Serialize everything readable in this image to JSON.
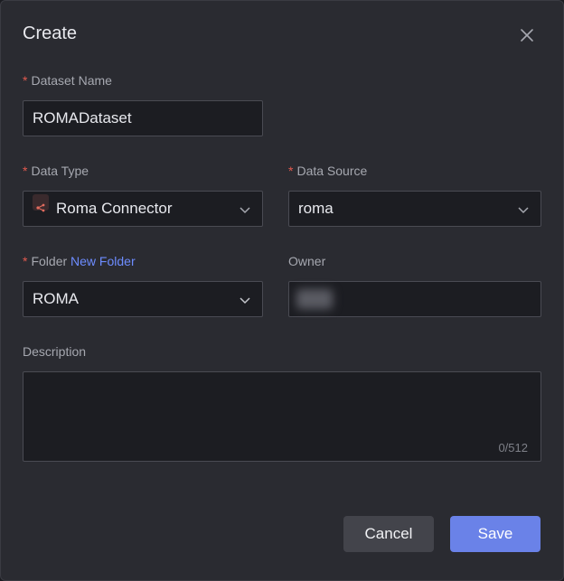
{
  "dialog": {
    "title": "Create",
    "required_mark": "*"
  },
  "dataset_name": {
    "label": "Dataset Name",
    "value": "ROMADataset"
  },
  "data_type": {
    "label": "Data Type",
    "value": "Roma Connector",
    "icon": "connector-icon"
  },
  "data_source": {
    "label": "Data Source",
    "value": "roma"
  },
  "folder": {
    "label": "Folder",
    "link": "New Folder",
    "value": "ROMA"
  },
  "owner": {
    "label": "Owner",
    "value_redacted": true
  },
  "description": {
    "label": "Description",
    "value": "",
    "counter": "0/512"
  },
  "buttons": {
    "cancel": "Cancel",
    "save": "Save"
  },
  "colors": {
    "accent": "#6a82e8",
    "required": "#e25a4f",
    "link": "#6d8cff"
  }
}
